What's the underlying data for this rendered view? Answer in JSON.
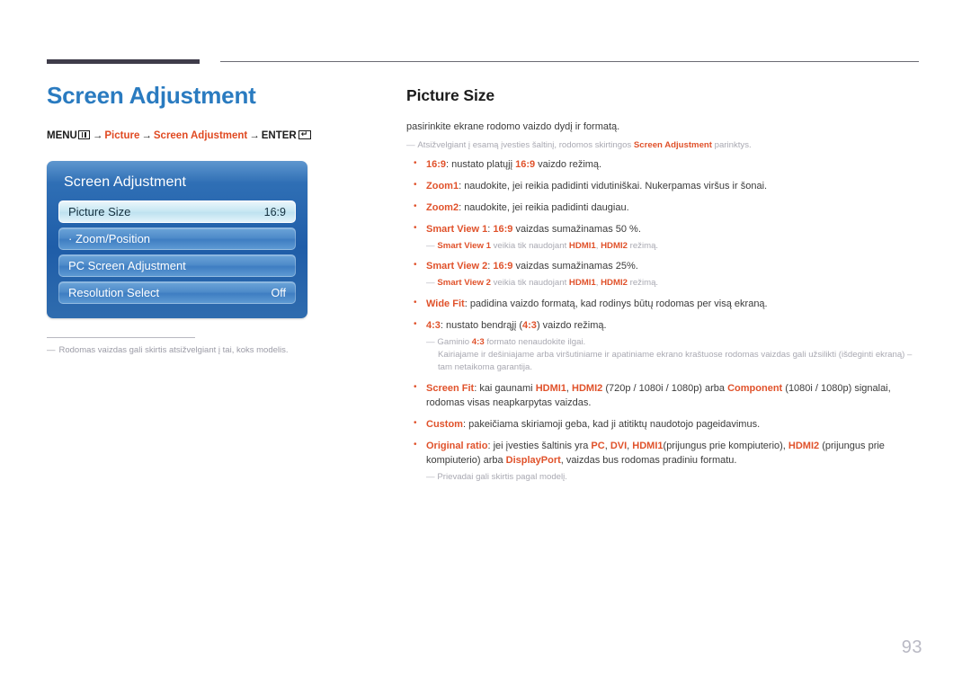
{
  "page": {
    "number": "93"
  },
  "left": {
    "chapter_title": "Screen Adjustment",
    "breadcrumb": {
      "menu_label": "MENU",
      "menu_icon": "menu-bars-icon",
      "arrow": "→",
      "item1": "Picture",
      "item2": "Screen Adjustment",
      "enter_label": "ENTER",
      "enter_icon": "enter-return-icon"
    },
    "osd": {
      "title": "Screen Adjustment",
      "rows": [
        {
          "label": "Picture Size",
          "value": "16:9",
          "selected": true
        },
        {
          "label": "· Zoom/Position",
          "value": "",
          "selected": false
        },
        {
          "label": "PC Screen Adjustment",
          "value": "",
          "selected": false
        },
        {
          "label": "Resolution Select",
          "value": "Off",
          "selected": false
        }
      ]
    },
    "note": {
      "dash": "―",
      "text": "Rodomas vaizdas gali skirtis atsižvelgiant į tai, koks modelis."
    }
  },
  "right": {
    "section_title": "Picture Size",
    "intro": "pasirinkite ekrane rodomo vaizdo dydį ir formatą.",
    "top_note": {
      "dash": "―",
      "pre": "Atsižvelgiant į esamą įvesties šaltinį, rodomos skirtingos ",
      "accent": "Screen Adjustment",
      "post": " parinktys."
    },
    "bullets": [
      {
        "term": "16:9",
        "sep": ": ",
        "parts": [
          {
            "t": "nustato platųjį ",
            "a": false
          },
          {
            "t": "16:9",
            "a": true
          },
          {
            "t": " vaizdo režimą.",
            "a": false
          }
        ]
      },
      {
        "term": "Zoom1",
        "sep": ": ",
        "parts": [
          {
            "t": "naudokite, jei reikia padidinti vidutiniškai. Nukerpamas viršus ir šonai.",
            "a": false
          }
        ]
      },
      {
        "term": "Zoom2",
        "sep": ": ",
        "parts": [
          {
            "t": "naudokite, jei reikia padidinti daugiau.",
            "a": false
          }
        ]
      },
      {
        "term": "Smart View 1",
        "sep": ": ",
        "parts": [
          {
            "t": "16:9",
            "a": true
          },
          {
            "t": " vaizdas sumažinamas 50 %.",
            "a": false
          }
        ],
        "note": {
          "dash": "―",
          "parts": [
            {
              "t": "Smart View 1",
              "a": true
            },
            {
              "t": " veikia tik naudojant ",
              "a": false
            },
            {
              "t": "HDMI1",
              "a": true
            },
            {
              "t": ", ",
              "a": false
            },
            {
              "t": "HDMI2",
              "a": true
            },
            {
              "t": " režimą.",
              "a": false
            }
          ]
        }
      },
      {
        "term": "Smart View 2",
        "sep": ": ",
        "parts": [
          {
            "t": "16:9",
            "a": true
          },
          {
            "t": " vaizdas sumažinamas 25%.",
            "a": false
          }
        ],
        "note": {
          "dash": "―",
          "parts": [
            {
              "t": "Smart View 2",
              "a": true
            },
            {
              "t": " veikia tik naudojant ",
              "a": false
            },
            {
              "t": "HDMI1",
              "a": true
            },
            {
              "t": ", ",
              "a": false
            },
            {
              "t": "HDMI2",
              "a": true
            },
            {
              "t": " režimą.",
              "a": false
            }
          ]
        }
      },
      {
        "term": "Wide Fit",
        "sep": ": ",
        "parts": [
          {
            "t": "padidina vaizdo formatą, kad rodinys būtų rodomas per visą ekraną.",
            "a": false
          }
        ]
      },
      {
        "term": "4:3",
        "sep": ": ",
        "parts": [
          {
            "t": "nustato bendrąjį (",
            "a": false
          },
          {
            "t": "4:3",
            "a": true
          },
          {
            "t": ") vaizdo režimą.",
            "a": false
          }
        ],
        "note": {
          "dash": "―",
          "parts": [
            {
              "t": "Gaminio ",
              "a": false
            },
            {
              "t": "4:3",
              "a": true
            },
            {
              "t": " formato nenaudokite ilgai.",
              "a": false
            }
          ],
          "cont": "Kairiajame ir dešiniajame arba viršutiniame ir apatiniame ekrano kraštuose rodomas vaizdas gali užsilikti (išdeginti ekraną) – tam netaikoma garantija."
        }
      },
      {
        "term": "Screen Fit",
        "sep": ": ",
        "parts": [
          {
            "t": "kai gaunami ",
            "a": false
          },
          {
            "t": "HDMI1",
            "a": true
          },
          {
            "t": ", ",
            "a": false
          },
          {
            "t": "HDMI2",
            "a": true
          },
          {
            "t": " (720p / 1080i / 1080p) arba ",
            "a": false
          },
          {
            "t": "Component",
            "a": true
          },
          {
            "t": " (1080i / 1080p) signalai, rodomas visas neapkarpytas vaizdas.",
            "a": false
          }
        ]
      },
      {
        "term": "Custom",
        "sep": ": ",
        "parts": [
          {
            "t": "pakeičiama skiriamoji geba, kad ji atitiktų naudotojo pageidavimus.",
            "a": false
          }
        ]
      },
      {
        "term": "Original ratio",
        "sep": ": ",
        "parts": [
          {
            "t": "jei įvesties šaltinis yra ",
            "a": false
          },
          {
            "t": "PC",
            "a": true
          },
          {
            "t": ", ",
            "a": false
          },
          {
            "t": "DVI",
            "a": true
          },
          {
            "t": ", ",
            "a": false
          },
          {
            "t": "HDMI1",
            "a": true
          },
          {
            "t": "(prijungus prie kompiuterio), ",
            "a": false
          },
          {
            "t": "HDMI2",
            "a": true
          },
          {
            "t": " (prijungus prie kompiuterio) arba ",
            "a": false
          },
          {
            "t": "DisplayPort",
            "a": true
          },
          {
            "t": ", vaizdas bus rodomas pradiniu formatu.",
            "a": false
          }
        ],
        "note": {
          "dash": "―",
          "parts": [
            {
              "t": "Prievadai gali skirtis pagal modelį.",
              "a": false
            }
          ]
        }
      }
    ]
  }
}
